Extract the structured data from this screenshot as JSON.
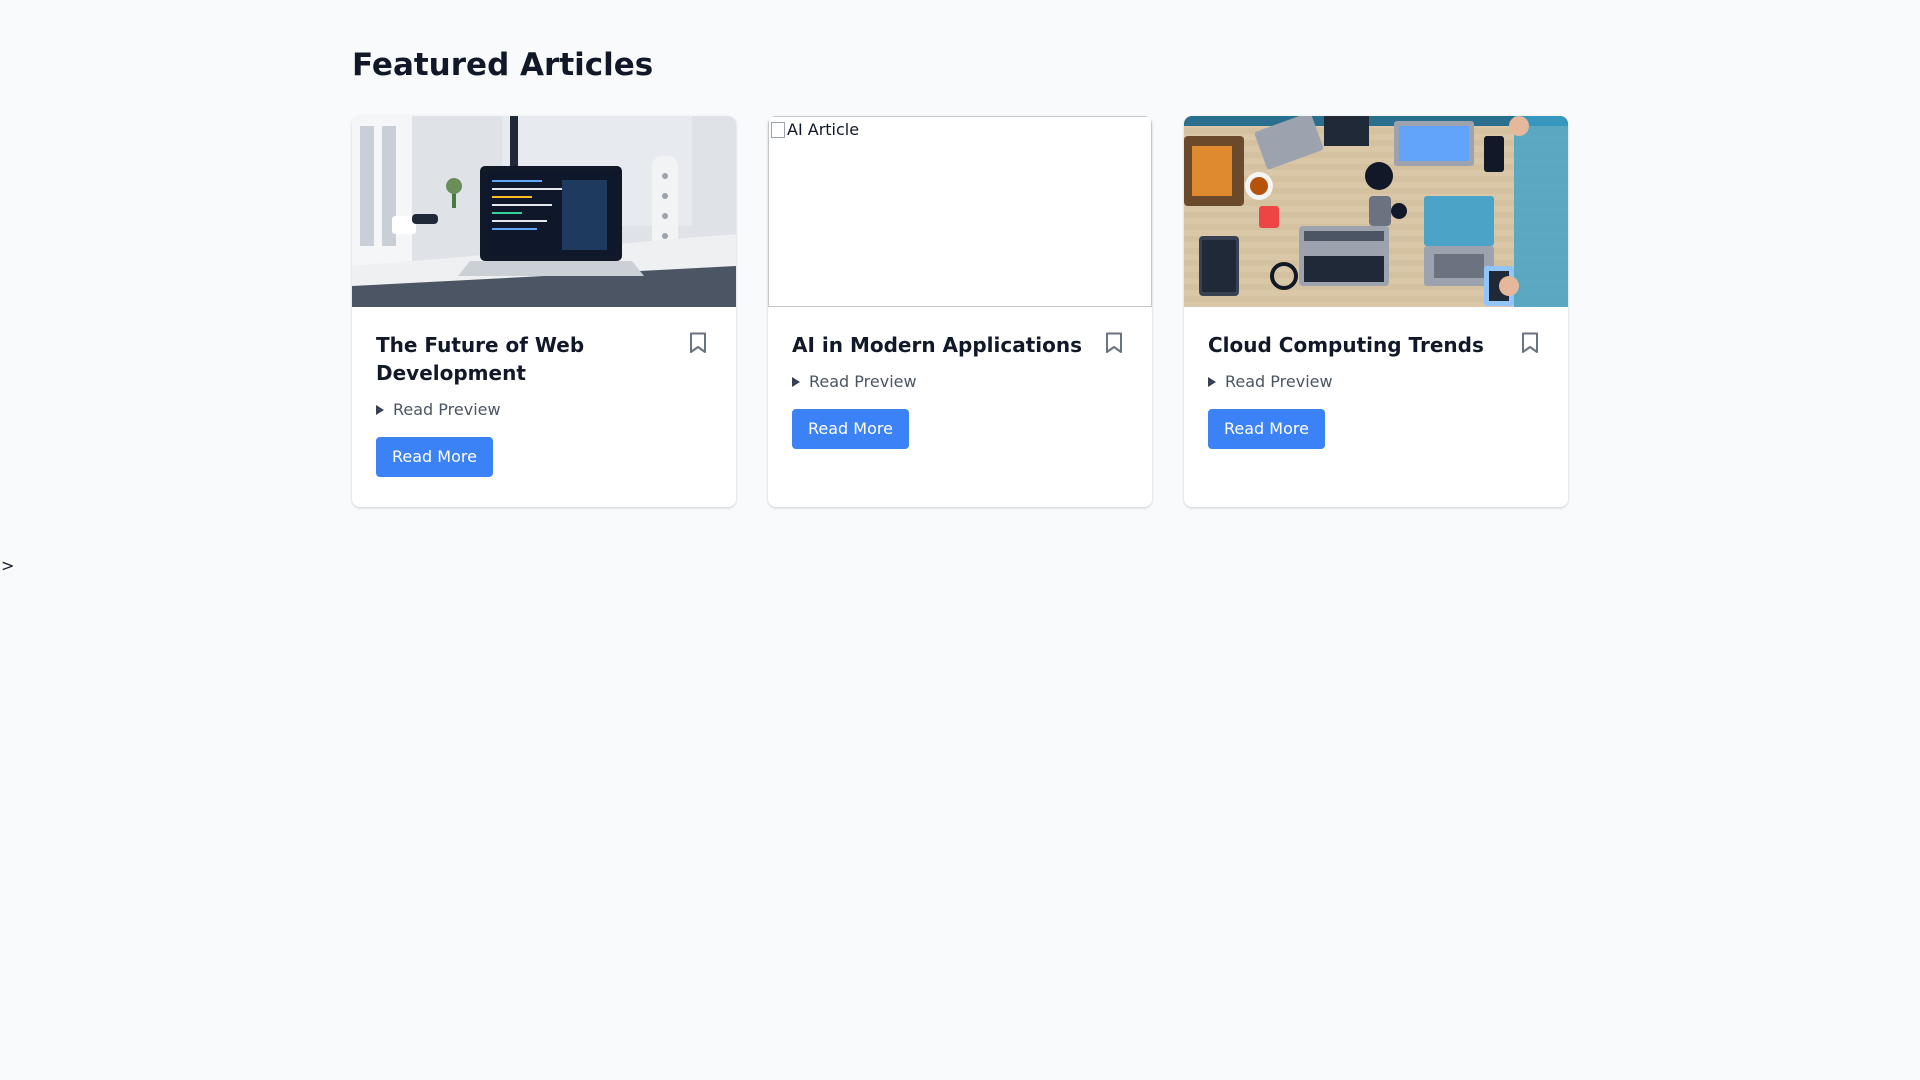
{
  "page": {
    "title": "Featured Articles",
    "stray_text": ">"
  },
  "colors": {
    "background": "#f8fafc",
    "accent": "#3b82f6",
    "title": "#111827",
    "muted": "#4b5563",
    "icon": "#6b7280"
  },
  "articles": [
    {
      "title": "The Future of Web Development",
      "preview_label": "Read Preview",
      "button_label": "Read More",
      "image": "laptop-code-photo",
      "bookmark_icon": "bookmark-icon"
    },
    {
      "title": "AI in Modern Applications",
      "preview_label": "Read Preview",
      "button_label": "Read More",
      "image_alt": "AI Article",
      "image": "broken-image",
      "bookmark_icon": "bookmark-icon"
    },
    {
      "title": "Cloud Computing Trends",
      "preview_label": "Read Preview",
      "button_label": "Read More",
      "image": "team-laptops-photo",
      "bookmark_icon": "bookmark-icon"
    }
  ]
}
